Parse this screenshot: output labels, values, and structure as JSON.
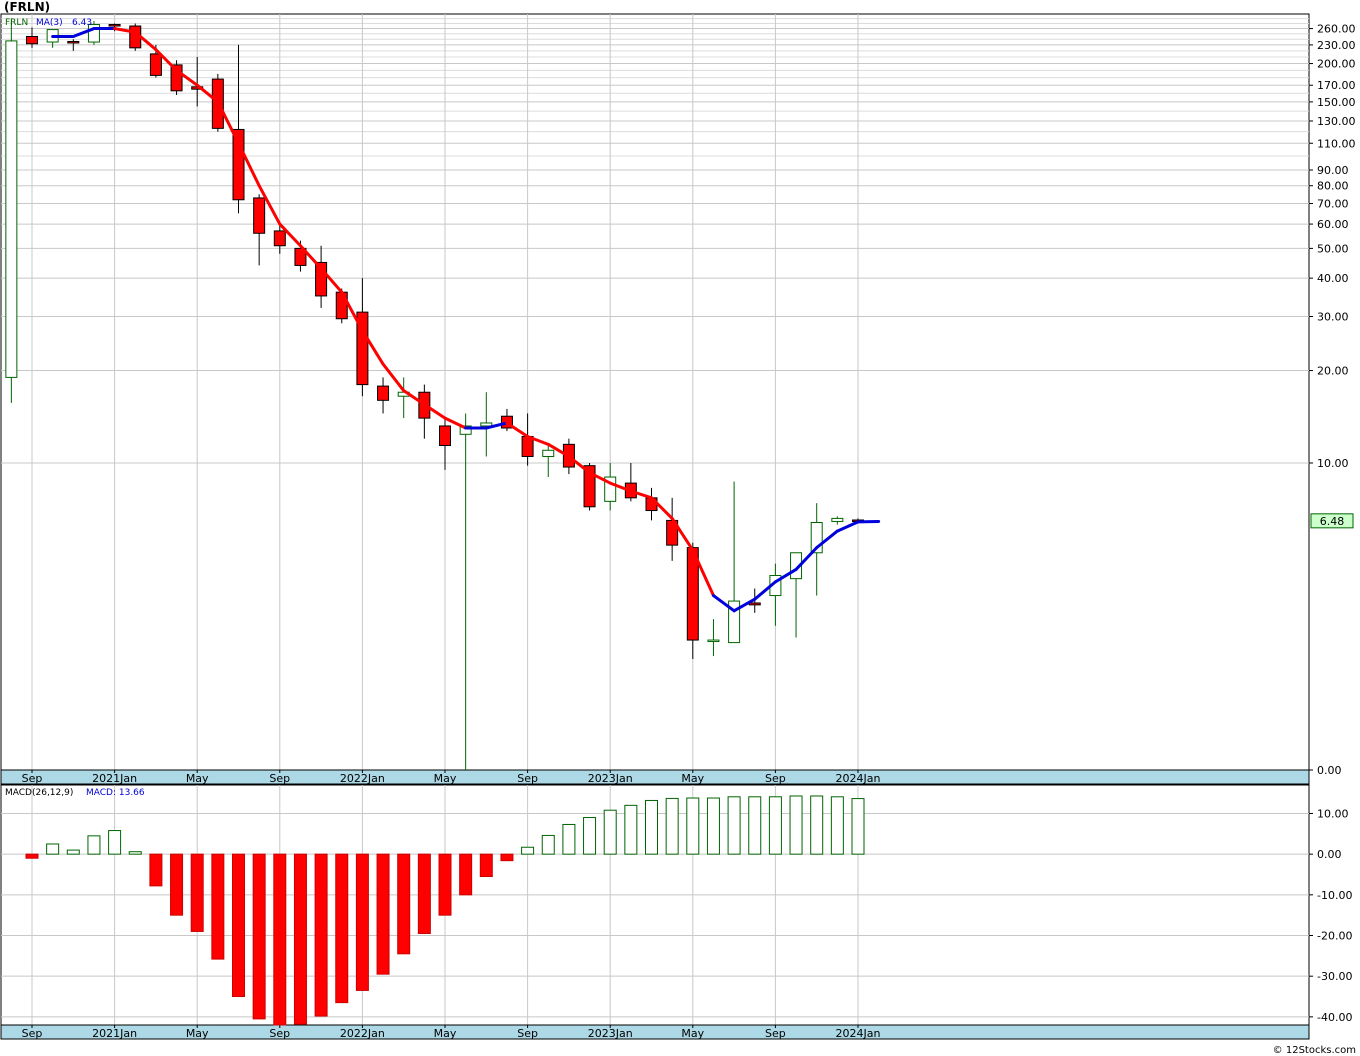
{
  "chart_title": "(FRLN)",
  "copyright": "© 12Stocks.com",
  "colors": {
    "up": "#006400",
    "down": "#ff0000",
    "ma_down": "#ff0000",
    "ma_up": "#0000dd",
    "axis_band": "#add8e6",
    "grid": "#c8c8c8"
  },
  "chart_data": [
    {
      "type": "candlestick",
      "scale": "log",
      "legend": {
        "symbol": "FRLN",
        "ma_label": "MA(3)",
        "ma_value": "6.43"
      },
      "last_price_label": "6.48",
      "y_tick_labels": [
        "260.00",
        "230.00",
        "200.00",
        "170.00",
        "150.00",
        "130.00",
        "110.00",
        "90.00",
        "80.00",
        "70.00",
        "60.00",
        "50.00",
        "40.00",
        "30.00",
        "20.00",
        "10.00",
        "0.00"
      ],
      "y_tick_values": [
        260,
        230,
        200,
        170,
        150,
        130,
        110,
        90,
        80,
        70,
        60,
        50,
        40,
        30,
        20,
        10,
        1
      ],
      "ylim": [
        1,
        290
      ],
      "x_tick_labels": [
        "Sep",
        "2021Jan",
        "May",
        "Sep",
        "2022Jan",
        "May",
        "Sep",
        "2023Jan",
        "May",
        "Sep",
        "2024Jan"
      ],
      "x_tick_months": [
        "2020-09",
        "2021-01",
        "2021-05",
        "2021-09",
        "2022-01",
        "2022-05",
        "2022-09",
        "2023-01",
        "2023-05",
        "2023-09",
        "2024-01"
      ],
      "candles": [
        {
          "m": "2020-08",
          "o": 19,
          "h": 280,
          "l": 15.7,
          "c": 237
        },
        {
          "m": "2020-09",
          "o": 245,
          "h": 262,
          "l": 225,
          "c": 232
        },
        {
          "m": "2020-10",
          "o": 235,
          "h": 255,
          "l": 225,
          "c": 258
        },
        {
          "m": "2020-11",
          "o": 236,
          "h": 240,
          "l": 220,
          "c": 235
        },
        {
          "m": "2020-12",
          "o": 235,
          "h": 275,
          "l": 230,
          "c": 268
        },
        {
          "m": "2021-01",
          "o": 268,
          "h": 270,
          "l": 255,
          "c": 265
        },
        {
          "m": "2021-02",
          "o": 265,
          "h": 270,
          "l": 220,
          "c": 225
        },
        {
          "m": "2021-03",
          "o": 215,
          "h": 230,
          "l": 180,
          "c": 183
        },
        {
          "m": "2021-04",
          "o": 198,
          "h": 205,
          "l": 158,
          "c": 163
        },
        {
          "m": "2021-05",
          "o": 168,
          "h": 210,
          "l": 145,
          "c": 165
        },
        {
          "m": "2021-06",
          "o": 178,
          "h": 185,
          "l": 120,
          "c": 123
        },
        {
          "m": "2021-07",
          "o": 122,
          "h": 230,
          "l": 65,
          "c": 72
        },
        {
          "m": "2021-08",
          "o": 73,
          "h": 75,
          "l": 44,
          "c": 56
        },
        {
          "m": "2021-09",
          "o": 57,
          "h": 60,
          "l": 48,
          "c": 51
        },
        {
          "m": "2021-10",
          "o": 50,
          "h": 53,
          "l": 42,
          "c": 44
        },
        {
          "m": "2021-11",
          "o": 45,
          "h": 51,
          "l": 32,
          "c": 35
        },
        {
          "m": "2021-12",
          "o": 36,
          "h": 37,
          "l": 28.5,
          "c": 29.5
        },
        {
          "m": "2022-01",
          "o": 31,
          "h": 40,
          "l": 16.5,
          "c": 18
        },
        {
          "m": "2022-02",
          "o": 17.8,
          "h": 19,
          "l": 14.5,
          "c": 16
        },
        {
          "m": "2022-03",
          "o": 16.5,
          "h": 19,
          "l": 14,
          "c": 17
        },
        {
          "m": "2022-04",
          "o": 17,
          "h": 18,
          "l": 12,
          "c": 14
        },
        {
          "m": "2022-05",
          "o": 13.2,
          "h": 14,
          "l": 9.5,
          "c": 11.4
        },
        {
          "m": "2022-06",
          "o": 12.4,
          "h": 14.5,
          "l": 1,
          "c": 13.2
        },
        {
          "m": "2022-07",
          "o": 13.2,
          "h": 17,
          "l": 10.5,
          "c": 13.5
        },
        {
          "m": "2022-08",
          "o": 14.2,
          "h": 15,
          "l": 12.7,
          "c": 13
        },
        {
          "m": "2022-09",
          "o": 12.2,
          "h": 14.5,
          "l": 9.8,
          "c": 10.5
        },
        {
          "m": "2022-10",
          "o": 10.5,
          "h": 11.5,
          "l": 9,
          "c": 11
        },
        {
          "m": "2022-11",
          "o": 11.5,
          "h": 12,
          "l": 9.2,
          "c": 9.7
        },
        {
          "m": "2022-12",
          "o": 9.8,
          "h": 10,
          "l": 7,
          "c": 7.2
        },
        {
          "m": "2023-01",
          "o": 7.5,
          "h": 10,
          "l": 7,
          "c": 9
        },
        {
          "m": "2023-02",
          "o": 8.6,
          "h": 10,
          "l": 7.5,
          "c": 7.7
        },
        {
          "m": "2023-03",
          "o": 7.7,
          "h": 8.3,
          "l": 6.5,
          "c": 7
        },
        {
          "m": "2023-04",
          "o": 6.5,
          "h": 7.7,
          "l": 4.8,
          "c": 5.4
        },
        {
          "m": "2023-05",
          "o": 5.3,
          "h": 5.5,
          "l": 2.3,
          "c": 2.65
        },
        {
          "m": "2023-06",
          "o": 2.65,
          "h": 3.1,
          "l": 2.35,
          "c": 2.65
        },
        {
          "m": "2023-07",
          "o": 2.6,
          "h": 8.7,
          "l": 2.6,
          "c": 3.55
        },
        {
          "m": "2023-08",
          "o": 3.5,
          "h": 3.9,
          "l": 3.25,
          "c": 3.45
        },
        {
          "m": "2023-09",
          "o": 3.7,
          "h": 4.7,
          "l": 2.95,
          "c": 4.3
        },
        {
          "m": "2023-10",
          "o": 4.2,
          "h": 4.3,
          "l": 2.7,
          "c": 5.1
        },
        {
          "m": "2023-11",
          "o": 5.1,
          "h": 7.4,
          "l": 3.7,
          "c": 6.4
        },
        {
          "m": "2023-12",
          "o": 6.45,
          "h": 6.7,
          "l": 6.3,
          "c": 6.6
        },
        {
          "m": "2024-01",
          "o": 6.52,
          "h": 6.6,
          "l": 6.4,
          "c": 6.5
        }
      ],
      "ma3": [
        {
          "m": "2020-10",
          "v": 245,
          "dir": "up"
        },
        {
          "m": "2020-11",
          "v": 245,
          "dir": "up"
        },
        {
          "m": "2020-12",
          "v": 260,
          "dir": "up"
        },
        {
          "m": "2021-01",
          "v": 260,
          "dir": "up"
        },
        {
          "m": "2021-02",
          "v": 253,
          "dir": "down"
        },
        {
          "m": "2021-03",
          "v": 222,
          "dir": "down"
        },
        {
          "m": "2021-04",
          "v": 190,
          "dir": "down"
        },
        {
          "m": "2021-05",
          "v": 170,
          "dir": "down"
        },
        {
          "m": "2021-06",
          "v": 150,
          "dir": "down"
        },
        {
          "m": "2021-07",
          "v": 110,
          "dir": "down"
        },
        {
          "m": "2021-08",
          "v": 80,
          "dir": "down"
        },
        {
          "m": "2021-09",
          "v": 60,
          "dir": "down"
        },
        {
          "m": "2021-10",
          "v": 51,
          "dir": "down"
        },
        {
          "m": "2021-11",
          "v": 43,
          "dir": "down"
        },
        {
          "m": "2021-12",
          "v": 36,
          "dir": "down"
        },
        {
          "m": "2022-01",
          "v": 27,
          "dir": "down"
        },
        {
          "m": "2022-02",
          "v": 21,
          "dir": "down"
        },
        {
          "m": "2022-03",
          "v": 17.2,
          "dir": "down"
        },
        {
          "m": "2022-04",
          "v": 15.5,
          "dir": "down"
        },
        {
          "m": "2022-05",
          "v": 14,
          "dir": "down"
        },
        {
          "m": "2022-06",
          "v": 13,
          "dir": "down"
        },
        {
          "m": "2022-07",
          "v": 13,
          "dir": "up"
        },
        {
          "m": "2022-08",
          "v": 13.5,
          "dir": "up"
        },
        {
          "m": "2022-09",
          "v": 12.2,
          "dir": "down"
        },
        {
          "m": "2022-10",
          "v": 11.5,
          "dir": "down"
        },
        {
          "m": "2022-11",
          "v": 10.5,
          "dir": "down"
        },
        {
          "m": "2022-12",
          "v": 9.3,
          "dir": "down"
        },
        {
          "m": "2023-01",
          "v": 8.6,
          "dir": "down"
        },
        {
          "m": "2023-02",
          "v": 8.1,
          "dir": "down"
        },
        {
          "m": "2023-03",
          "v": 7.7,
          "dir": "down"
        },
        {
          "m": "2023-04",
          "v": 6.6,
          "dir": "down"
        },
        {
          "m": "2023-05",
          "v": 5.2,
          "dir": "down"
        },
        {
          "m": "2023-06",
          "v": 3.7,
          "dir": "down"
        },
        {
          "m": "2023-07",
          "v": 3.3,
          "dir": "up"
        },
        {
          "m": "2023-08",
          "v": 3.6,
          "dir": "up"
        },
        {
          "m": "2023-09",
          "v": 4.1,
          "dir": "up"
        },
        {
          "m": "2023-10",
          "v": 4.5,
          "dir": "up"
        },
        {
          "m": "2023-11",
          "v": 5.3,
          "dir": "up"
        },
        {
          "m": "2023-12",
          "v": 6.0,
          "dir": "up"
        },
        {
          "m": "2024-01",
          "v": 6.43,
          "dir": "up"
        },
        {
          "m": "2024-02",
          "v": 6.45,
          "dir": "up"
        }
      ]
    },
    {
      "type": "bar",
      "legend": {
        "label": "MACD(26,12,9)",
        "value_label": "MACD: 13.66"
      },
      "y_tick_labels": [
        "10.00",
        "0.00",
        "-10.00",
        "-20.00",
        "-30.00",
        "-40.00"
      ],
      "y_tick_values": [
        10,
        0,
        -10,
        -20,
        -30,
        -40
      ],
      "ylim": [
        -42,
        17
      ],
      "x_tick_labels": [
        "Sep",
        "2021Jan",
        "May",
        "Sep",
        "2022Jan",
        "May",
        "Sep",
        "2023Jan",
        "May",
        "Sep",
        "2024Jan"
      ],
      "bars": [
        {
          "m": "2020-09",
          "v": -1
        },
        {
          "m": "2020-10",
          "v": 2.5
        },
        {
          "m": "2020-11",
          "v": 1
        },
        {
          "m": "2020-12",
          "v": 4.5
        },
        {
          "m": "2021-01",
          "v": 5.8
        },
        {
          "m": "2021-02",
          "v": 0.6
        },
        {
          "m": "2021-03",
          "v": -7.8
        },
        {
          "m": "2021-04",
          "v": -15
        },
        {
          "m": "2021-05",
          "v": -19
        },
        {
          "m": "2021-06",
          "v": -25.8
        },
        {
          "m": "2021-07",
          "v": -35
        },
        {
          "m": "2021-08",
          "v": -40.5
        },
        {
          "m": "2021-09",
          "v": -42
        },
        {
          "m": "2021-10",
          "v": -41.8
        },
        {
          "m": "2021-11",
          "v": -39.8
        },
        {
          "m": "2021-12",
          "v": -36.5
        },
        {
          "m": "2022-01",
          "v": -33.5
        },
        {
          "m": "2022-02",
          "v": -29.5
        },
        {
          "m": "2022-03",
          "v": -24.5
        },
        {
          "m": "2022-04",
          "v": -19.5
        },
        {
          "m": "2022-05",
          "v": -15
        },
        {
          "m": "2022-06",
          "v": -10
        },
        {
          "m": "2022-07",
          "v": -5.5
        },
        {
          "m": "2022-08",
          "v": -1.6
        },
        {
          "m": "2022-09",
          "v": 1.7
        },
        {
          "m": "2022-10",
          "v": 4.6
        },
        {
          "m": "2022-11",
          "v": 7.3
        },
        {
          "m": "2022-12",
          "v": 9
        },
        {
          "m": "2023-01",
          "v": 10.8
        },
        {
          "m": "2023-02",
          "v": 12
        },
        {
          "m": "2023-03",
          "v": 13.2
        },
        {
          "m": "2023-04",
          "v": 13.7
        },
        {
          "m": "2023-05",
          "v": 13.8
        },
        {
          "m": "2023-06",
          "v": 13.8
        },
        {
          "m": "2023-07",
          "v": 14.1
        },
        {
          "m": "2023-08",
          "v": 14.1
        },
        {
          "m": "2023-09",
          "v": 14.1
        },
        {
          "m": "2023-10",
          "v": 14.3
        },
        {
          "m": "2023-11",
          "v": 14.3
        },
        {
          "m": "2023-12",
          "v": 14.1
        },
        {
          "m": "2024-01",
          "v": 13.66
        }
      ]
    }
  ]
}
